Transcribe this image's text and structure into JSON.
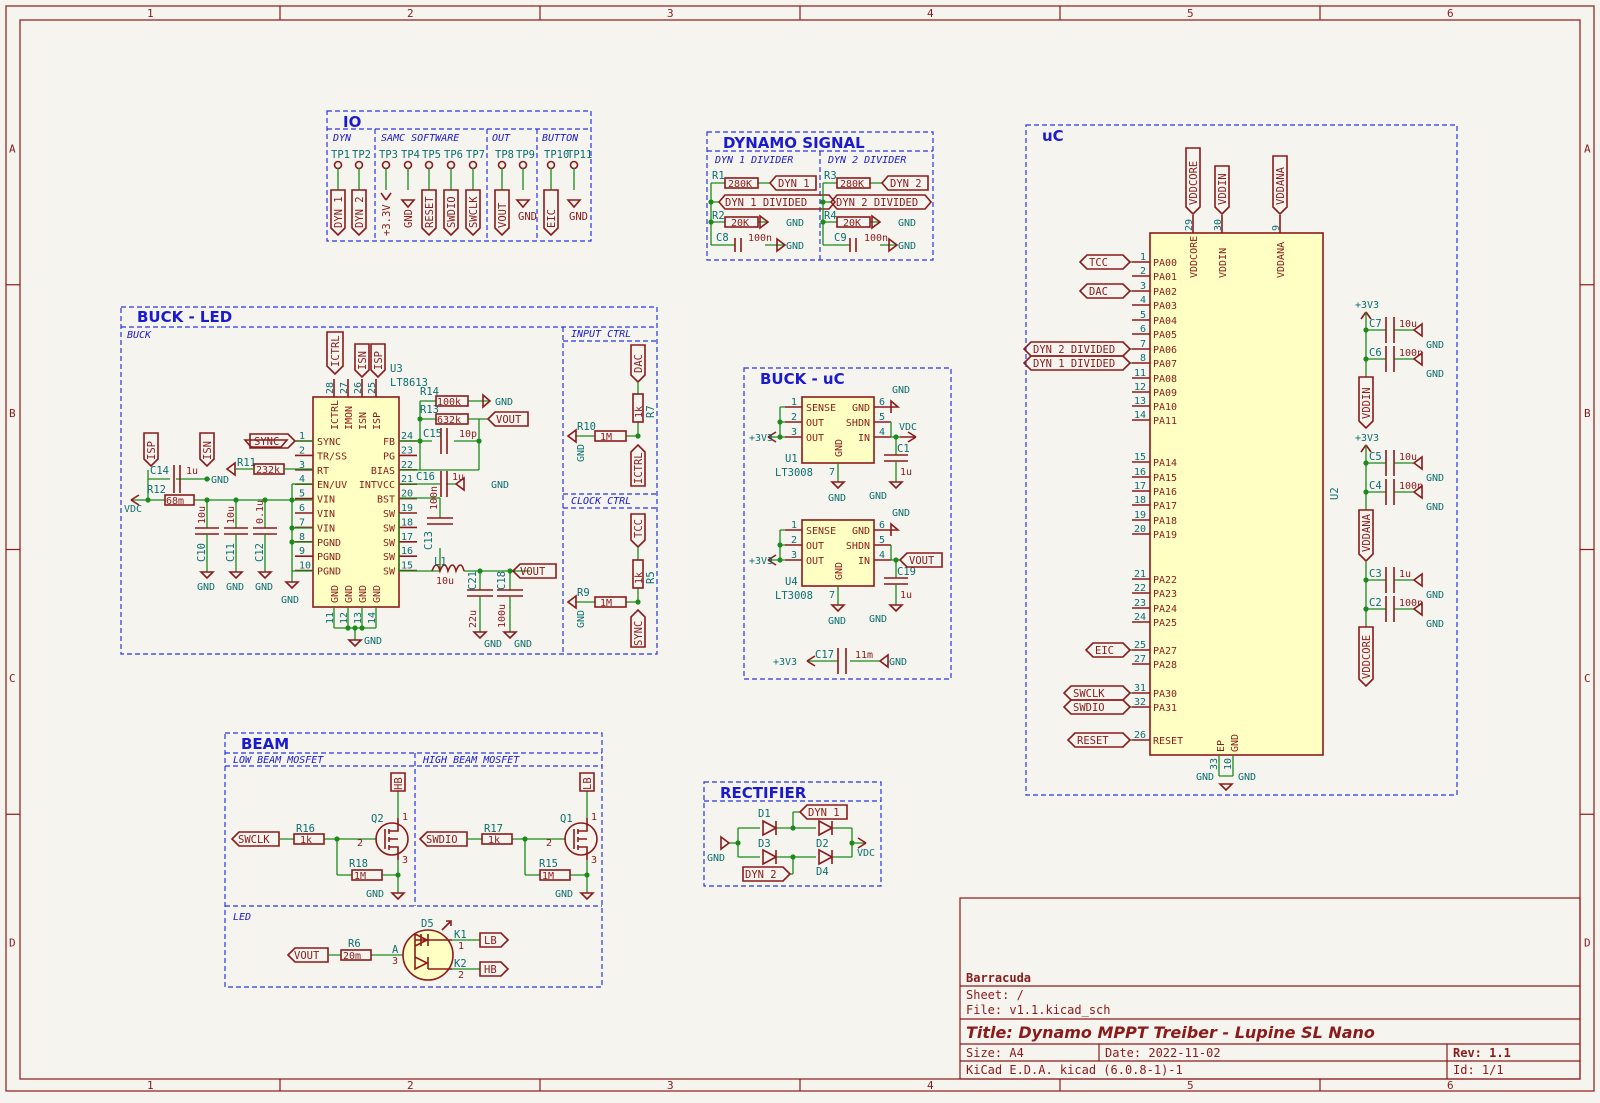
{
  "zones": {
    "columns": [
      "1",
      "2",
      "3",
      "4",
      "5",
      "6"
    ],
    "rows": [
      "A",
      "B",
      "C",
      "D"
    ]
  },
  "groups": {
    "io": {
      "title": "IO",
      "sub": [
        "DYN",
        "SAMC SOFTWARE",
        "OUT",
        "BUTTON"
      ],
      "tps": [
        "TP1",
        "TP2",
        "TP3",
        "TP4",
        "TP5",
        "TP6",
        "TP7",
        "TP8",
        "TP9",
        "TP10",
        "TP11"
      ],
      "nets": [
        "DYN 1",
        "DYN 2",
        "+3.3V",
        "GND",
        "RESET",
        "SWDIO",
        "SWCLK",
        "VOUT",
        "GND",
        "EIC",
        "GND"
      ]
    },
    "dynamo": {
      "title": "DYNAMO SIGNAL",
      "sub": [
        "DYN 1 DIVIDER",
        "DYN 2 DIVIDER"
      ],
      "r1": "R1",
      "r1v": "280K",
      "r2": "R2",
      "r2v": "20K",
      "c8": "C8",
      "c8v": "100n",
      "r3": "R3",
      "r3v": "280K",
      "r4": "R4",
      "r4v": "20K",
      "c9": "C9",
      "c9v": "100n",
      "n_dyn1": "DYN 1",
      "n_dyn2": "DYN 2",
      "n_dyn1d": "DYN 1 DIVIDED",
      "n_dyn2d": "DYN 2 DIVIDED",
      "gnd": "GND"
    },
    "buck_led": {
      "title": "BUCK - LED",
      "sub": [
        "BUCK",
        "INPUT CTRL",
        "CLOCK CTRL"
      ],
      "u3": "U3",
      "u3v": "LT8613",
      "left_pins": [
        [
          "SYNC",
          "1"
        ],
        [
          "TR/SS",
          "2"
        ],
        [
          "RT",
          "3"
        ],
        [
          "EN/UV",
          "4"
        ],
        [
          "VIN",
          "5"
        ],
        [
          "VIN",
          "6"
        ],
        [
          "VIN",
          "7"
        ],
        [
          "PGND",
          "8"
        ],
        [
          "PGND",
          "9"
        ],
        [
          "PGND",
          "10"
        ]
      ],
      "right_pins": [
        [
          "FB",
          "24"
        ],
        [
          "PG",
          "23"
        ],
        [
          "BIAS",
          "22"
        ],
        [
          "INTVCC",
          "21"
        ],
        [
          "BST",
          "20"
        ],
        [
          "SW",
          "19"
        ],
        [
          "SW",
          "18"
        ],
        [
          "SW",
          "17"
        ],
        [
          "SW",
          "16"
        ],
        [
          "SW",
          "15"
        ]
      ],
      "top_pins": [
        [
          "ICTRL",
          "28"
        ],
        [
          "IMON",
          "27"
        ],
        [
          "ISN",
          "26"
        ],
        [
          "ISP",
          "25"
        ]
      ],
      "bot_pins": [
        [
          "GND",
          "11"
        ],
        [
          "GND",
          "12"
        ],
        [
          "GND",
          "13"
        ],
        [
          "GND",
          "14"
        ]
      ],
      "parts": {
        "r14": "R14",
        "r14v": "100k",
        "r13": "R13",
        "r13v": "632k",
        "c15": "C15",
        "c15v": "10p",
        "c16": "C16",
        "c16v": "1u",
        "c13": "C13",
        "c13v": "100n",
        "l1": "L1",
        "l1v": "10u",
        "c21": "C21",
        "c21v": "22u",
        "c18": "C18",
        "c18v": "100u",
        "r11": "R11",
        "r11v": "232k",
        "c14": "C14",
        "c14v": "1u",
        "r12": "R12",
        "r12v": "68m",
        "c10": "C10",
        "c10v": "10u",
        "c11": "C11",
        "c11v": "10u",
        "c12": "C12",
        "c12v": "0.1u",
        "r10": "R10",
        "r10v": "1M",
        "r7": "R7",
        "r7v": "1k",
        "r9": "R9",
        "r9v": "1M",
        "r5": "R5",
        "r5v": "1k"
      },
      "nets": {
        "ictrl": "ICTRL",
        "isn": "ISN",
        "isp": "ISP",
        "sync": "SYNC",
        "vdc": "VDC",
        "gnd": "GND",
        "vout": "VOUT",
        "dac": "DAC",
        "tcc": "TCC"
      }
    },
    "buck_uc": {
      "title": "BUCK - uC",
      "u1": "U1",
      "u1v": "LT3008",
      "u4": "U4",
      "u4v": "LT3008",
      "pins_l": [
        [
          "SENSE",
          "1"
        ],
        [
          "OUT",
          "2"
        ],
        [
          "OUT",
          "3"
        ]
      ],
      "pins_r": [
        [
          "GND",
          "6"
        ],
        [
          "SHDN",
          "5"
        ],
        [
          "IN",
          "4"
        ]
      ],
      "gndpin": [
        "GND",
        "7"
      ],
      "c1": "C1",
      "c1v": "1u",
      "c19": "C19",
      "c19v": "1u",
      "c17": "C17",
      "c17v": "11m",
      "nets": {
        "v33": "+3V3",
        "gnd": "GND",
        "vdc": "VDC",
        "vout": "VOUT"
      }
    },
    "uc": {
      "title": "uC",
      "u2": "U2",
      "top": [
        [
          "VDDCORE",
          "29"
        ],
        [
          "VDDIN",
          "30"
        ],
        [
          "VDDANA",
          "9"
        ]
      ],
      "pins": [
        [
          "PA00",
          "1"
        ],
        [
          "PA01",
          "2"
        ],
        [
          "PA02",
          "3"
        ],
        [
          "PA03",
          "4"
        ],
        [
          "PA04",
          "5"
        ],
        [
          "PA05",
          "6"
        ],
        [
          "PA06",
          "7"
        ],
        [
          "PA07",
          "8"
        ],
        [
          "PA08",
          "11"
        ],
        [
          "PA09",
          "12"
        ],
        [
          "PA10",
          "13"
        ],
        [
          "PA11",
          "14"
        ],
        [
          "PA14",
          "15"
        ],
        [
          "PA15",
          "16"
        ],
        [
          "PA16",
          "17"
        ],
        [
          "PA17",
          "18"
        ],
        [
          "PA18",
          "19"
        ],
        [
          "PA19",
          "20"
        ],
        [
          "PA22",
          "21"
        ],
        [
          "PA23",
          "22"
        ],
        [
          "PA24",
          "23"
        ],
        [
          "PA25",
          "24"
        ],
        [
          "PA27",
          "25"
        ],
        [
          "PA28",
          "27"
        ],
        [
          "PA30",
          "31"
        ],
        [
          "PA31",
          "32"
        ],
        [
          "RESET",
          "26"
        ]
      ],
      "bottom": [
        [
          "EP",
          "33"
        ],
        [
          "GND",
          "10"
        ]
      ],
      "labels": {
        "tcc": "TCC",
        "dac": "DAC",
        "dyn2d": "DYN 2 DIVIDED",
        "dyn1d": "DYN 1 DIVIDED",
        "eic": "EIC",
        "swclk": "SWCLK",
        "swdio": "SWDIO",
        "reset": "RESET",
        "gnd": "GND"
      },
      "caps": [
        [
          "C7",
          "10u"
        ],
        [
          "C6",
          "100n"
        ],
        [
          "C5",
          "10u"
        ],
        [
          "C4",
          "100n"
        ],
        [
          "C3",
          "1u"
        ],
        [
          "C2",
          "100n"
        ]
      ],
      "rails": [
        "+3V3",
        "VDDIN",
        "+3V3",
        "VDDANA",
        "VDDCORE"
      ]
    },
    "beam": {
      "title": "BEAM",
      "sub": [
        "LOW BEAM MOSFET",
        "HIGH BEAM MOSFET",
        "LED"
      ],
      "r16": "R16",
      "r16v": "1k",
      "r18": "R18",
      "r18v": "1M",
      "q2": "Q2",
      "r17": "R17",
      "r17v": "1k",
      "r15": "R15",
      "r15v": "1M",
      "q1": "Q1",
      "r6": "R6",
      "r6v": "20m",
      "d5": "D5",
      "k1": "K1",
      "k2": "K2",
      "a": "A",
      "nets": {
        "swclk": "SWCLK",
        "swdio": "SWDIO",
        "hb": "HB",
        "lb": "LB",
        "gnd": "GND",
        "vout": "VOUT"
      }
    },
    "rect": {
      "title": "RECTIFIER",
      "d": [
        "D1",
        "D2",
        "D3",
        "D4"
      ],
      "nets": {
        "dyn1": "DYN 1",
        "dyn2": "DYN 2",
        "gnd": "GND",
        "vdc": "VDC"
      }
    }
  },
  "title_block": {
    "company": "Barracuda",
    "sheet": "Sheet: /",
    "file": "File: v1.1.kicad_sch",
    "title": "Title: Dynamo MPPT Treiber - Lupine SL Nano",
    "size": "Size: A4",
    "date": "Date: 2022-11-02",
    "rev": "Rev: 1.1",
    "tool": "KiCad E.D.A.  kicad (6.0.8-1)-1",
    "id": "Id: 1/1"
  }
}
